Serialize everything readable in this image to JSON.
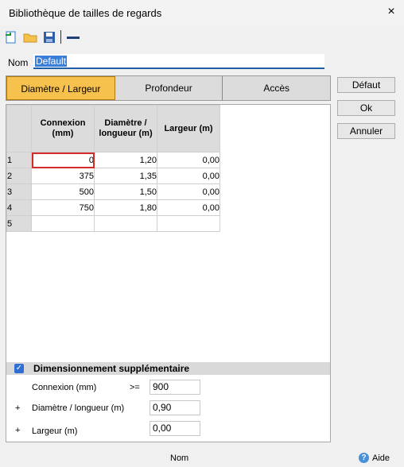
{
  "window": {
    "title": "Bibliothèque de tailles de regards",
    "close_icon": "×"
  },
  "toolbar": {
    "items": [
      "new-icon",
      "open-folder-icon",
      "save-icon",
      "dash-icon"
    ]
  },
  "name": {
    "label": "Nom",
    "value": "Default"
  },
  "tabs": [
    {
      "label": "Diamètre / Largeur",
      "active": true
    },
    {
      "label": "Profondeur",
      "active": false
    },
    {
      "label": "Accès",
      "active": false
    }
  ],
  "buttons": {
    "defaut": "Défaut",
    "ok": "Ok",
    "annuler": "Annuler"
  },
  "grid": {
    "headers": [
      "Connexion\n(mm)",
      "Diamètre /\nlongueur (m)",
      "Largeur (m)"
    ],
    "rows": [
      {
        "num": "1",
        "cells": [
          "0",
          "1,20",
          "0,00"
        ]
      },
      {
        "num": "2",
        "cells": [
          "375",
          "1,35",
          "0,00"
        ]
      },
      {
        "num": "3",
        "cells": [
          "500",
          "1,50",
          "0,00"
        ]
      },
      {
        "num": "4",
        "cells": [
          "750",
          "1,80",
          "0,00"
        ]
      },
      {
        "num": "5",
        "cells": [
          "",
          "",
          ""
        ]
      }
    ]
  },
  "supplementary": {
    "label": "Dimensionnement supplémentaire",
    "checked": true,
    "connexion_label": "Connexion (mm)",
    "operator": ">=",
    "connexion_value": "900",
    "plus": "+",
    "diametre_label": "Diamètre / longueur (m)",
    "diametre_value": "0,90",
    "largeur_label": "Largeur (m)",
    "largeur_value": "0,00"
  },
  "status": {
    "center": "Nom",
    "help": "Aide"
  },
  "colors": {
    "accent": "#f7c14e",
    "selection": "#3b7ed9",
    "error_outline": "#d42a2a"
  }
}
